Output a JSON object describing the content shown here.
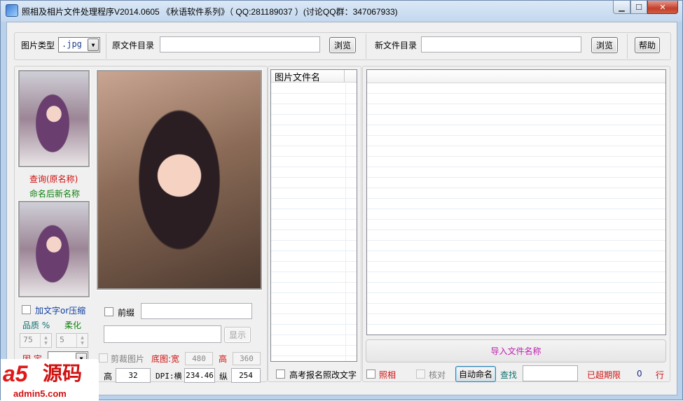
{
  "window": {
    "title": "照相及相片文件处理程序V2014.0605 《秋语软件系列》（ QQ:281189037 ）(讨论QQ群：347067933)",
    "close_icon": "close-icon",
    "min_icon": "minimize-icon",
    "max_icon": "maximize-icon"
  },
  "toolbar": {
    "type_label": "图片类型",
    "type_value": ".jpg",
    "src_dir_label": "原文件目录",
    "src_dir_value": "",
    "browse1": "浏览",
    "new_dir_label": "新文件目录",
    "new_dir_value": "",
    "browse2": "浏览",
    "help": "帮助"
  },
  "left": {
    "query_label": "查询(原名称)",
    "rename_label": "命名后新名称",
    "add_text_label": "加文字or压缩",
    "quality_label": "品质 %",
    "soften_label": "柔化",
    "quality_value": "75",
    "soften_value": "5",
    "fixed_label": "固 定"
  },
  "middle": {
    "prefix_label": "前缀",
    "prefix_value": "",
    "second_value": "",
    "show_button": "显示",
    "crop_label": "剪裁图片",
    "base_width_label": "底图:宽",
    "base_width_value": "480",
    "base_height_label": "高",
    "base_height_value": "360",
    "height_label": "高",
    "height_value": "32",
    "dpi_label": "DPI:横",
    "dpi_h_value": "234.46",
    "dpi_v_label": "纵",
    "dpi_v_value": "254"
  },
  "filelist": {
    "header": "图片文件名",
    "exam_label": "高考报名照改文字"
  },
  "right": {
    "import_button": "导入文件名称",
    "photo_label": "照相",
    "verify_label": "核对",
    "auto_name_button": "自动命名",
    "search_label": "查找",
    "search_value": "",
    "expired_label": "已超期限",
    "count_value": "0",
    "row_label": "行"
  },
  "watermark": {
    "logo": "a5",
    "brand": "源码",
    "url": "admin5.com"
  }
}
